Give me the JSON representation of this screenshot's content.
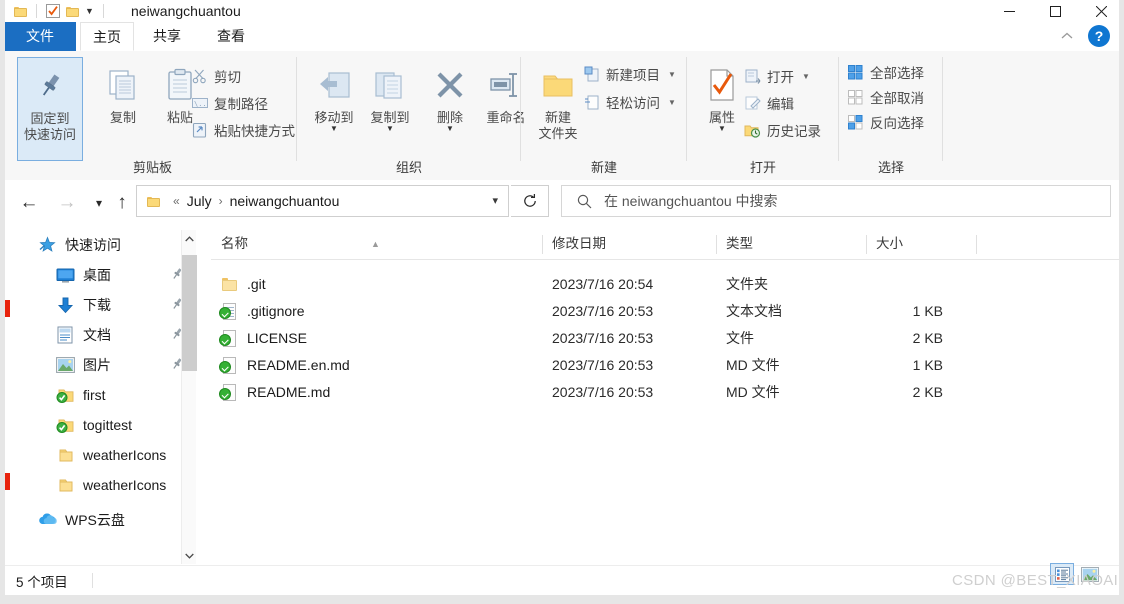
{
  "window": {
    "title": "neiwangchuantou",
    "quick_access_icons": [
      "folder-icon",
      "checkbox-checked-icon",
      "folder-icon",
      "chevron-down-icon"
    ],
    "controls": {
      "minimize": "minimize-icon",
      "maximize": "maximize-icon",
      "close": "close-icon"
    }
  },
  "ribbon": {
    "tabs": [
      {
        "label": "文件",
        "active": false,
        "is_file_menu": true
      },
      {
        "label": "主页",
        "active": true
      },
      {
        "label": "共享",
        "active": false
      },
      {
        "label": "查看",
        "active": false
      }
    ],
    "collapse_icon": "chevron-up-icon",
    "help_label": "?",
    "groups": [
      {
        "name": "剪贴板",
        "big_buttons": [
          {
            "label": "固定到\n快速访问",
            "line1": "固定到",
            "line2": "快速访问",
            "icon": "pin-icon",
            "selected": true
          },
          {
            "label": "复制",
            "icon": "copy-icon"
          },
          {
            "label": "粘贴",
            "icon": "paste-icon"
          }
        ],
        "small_buttons": [
          {
            "label": "剪切",
            "icon": "scissors-icon"
          },
          {
            "label": "复制路径",
            "icon": "copy-path-icon"
          },
          {
            "label": "粘贴快捷方式",
            "icon": "paste-shortcut-icon"
          }
        ]
      },
      {
        "name": "组织",
        "big_buttons": [
          {
            "label": "移动到",
            "icon": "move-to-icon",
            "has_caret": true
          },
          {
            "label": "复制到",
            "icon": "copy-to-icon",
            "has_caret": true
          },
          {
            "label": "删除",
            "icon": "delete-x-icon",
            "has_caret": true
          },
          {
            "label": "重命名",
            "icon": "rename-icon"
          }
        ]
      },
      {
        "name": "新建",
        "big_buttons": [
          {
            "label": "新建\n文件夹",
            "line1": "新建",
            "line2": "文件夹",
            "icon": "new-folder-icon"
          }
        ],
        "small_buttons": [
          {
            "label": "新建项目",
            "icon": "new-item-icon",
            "has_caret": true
          },
          {
            "label": "轻松访问",
            "icon": "easy-access-icon",
            "has_caret": true
          }
        ]
      },
      {
        "name": "打开",
        "big_buttons": [
          {
            "label": "属性",
            "icon": "properties-icon",
            "has_caret": true
          }
        ],
        "small_buttons": [
          {
            "label": "打开",
            "icon": "open-icon",
            "has_caret": true
          },
          {
            "label": "编辑",
            "icon": "edit-icon"
          },
          {
            "label": "历史记录",
            "icon": "history-icon"
          }
        ]
      },
      {
        "name": "选择",
        "small_buttons": [
          {
            "label": "全部选择",
            "icon": "select-all-icon"
          },
          {
            "label": "全部取消",
            "icon": "select-none-icon"
          },
          {
            "label": "反向选择",
            "icon": "invert-selection-icon"
          }
        ]
      }
    ]
  },
  "navbar": {
    "back": "back-arrow-icon",
    "forward": "forward-arrow-icon",
    "recent": "chevron-down-icon",
    "up": "up-arrow-icon",
    "breadcrumb": {
      "icon": "folder-icon",
      "prefix": "«",
      "items": [
        "July",
        "neiwangchuantou"
      ],
      "separator": "›"
    },
    "dropdown": "chevron-down-icon",
    "refresh": "refresh-icon",
    "search": {
      "icon": "search-icon",
      "placeholder": "在 neiwangchuantou 中搜索",
      "value": ""
    }
  },
  "sidebar": {
    "items": [
      {
        "label": "快速访问",
        "icon": "star-quick-access-icon",
        "indent": 0,
        "pinned": false
      },
      {
        "label": "桌面",
        "icon": "desktop-icon",
        "indent": 1,
        "pinned": true
      },
      {
        "label": "下载",
        "icon": "downloads-icon",
        "indent": 1,
        "pinned": true
      },
      {
        "label": "文档",
        "icon": "documents-icon",
        "indent": 1,
        "pinned": true
      },
      {
        "label": "图片",
        "icon": "pictures-icon",
        "indent": 1,
        "pinned": true
      },
      {
        "label": "first",
        "icon": "git-folder-icon",
        "indent": 1,
        "pinned": false
      },
      {
        "label": "togittest",
        "icon": "git-folder-icon",
        "indent": 1,
        "pinned": false
      },
      {
        "label": "weatherIcons",
        "icon": "folder-icon",
        "indent": 1,
        "pinned": false
      },
      {
        "label": "weatherIcons",
        "icon": "folder-icon",
        "indent": 1,
        "pinned": false
      },
      {
        "label": "WPS云盘",
        "icon": "wps-cloud-icon",
        "indent": 0,
        "pinned": false
      }
    ],
    "scrollbar": {
      "up": "chevron-up-icon",
      "down": "chevron-down-icon"
    }
  },
  "filelist": {
    "columns": [
      {
        "label": "名称",
        "sorted": true,
        "sort_dir": "asc"
      },
      {
        "label": "修改日期"
      },
      {
        "label": "类型"
      },
      {
        "label": "大小"
      }
    ],
    "rows": [
      {
        "name": ".git",
        "icon": "folder-icon",
        "date": "2023/7/16 20:54",
        "type": "文件夹",
        "size": ""
      },
      {
        "name": ".gitignore",
        "icon": "git-file-icon",
        "date": "2023/7/16 20:53",
        "type": "文本文档",
        "size": "1 KB"
      },
      {
        "name": "LICENSE",
        "icon": "git-file-icon",
        "date": "2023/7/16 20:53",
        "type": "文件",
        "size": "2 KB"
      },
      {
        "name": "README.en.md",
        "icon": "git-file-icon",
        "date": "2023/7/16 20:53",
        "type": "MD 文件",
        "size": "1 KB"
      },
      {
        "name": "README.md",
        "icon": "git-file-icon",
        "date": "2023/7/16 20:53",
        "type": "MD 文件",
        "size": "2 KB"
      }
    ]
  },
  "statusbar": {
    "item_count": "5 个项目",
    "view_buttons": [
      {
        "name": "details-view",
        "icon": "details-view-icon",
        "active": true
      },
      {
        "name": "thumbnails-view",
        "icon": "thumbnails-view-icon",
        "active": false
      }
    ]
  },
  "watermark": {
    "text": "CSDN @BEST_XIAOAI"
  },
  "colors": {
    "accent": "#1b6ec2",
    "selection": "#dbeaf7",
    "selection_border": "#7aaee0",
    "folder": "#fbd978",
    "git_green": "#35b035",
    "mark_red": "#e8230d"
  }
}
